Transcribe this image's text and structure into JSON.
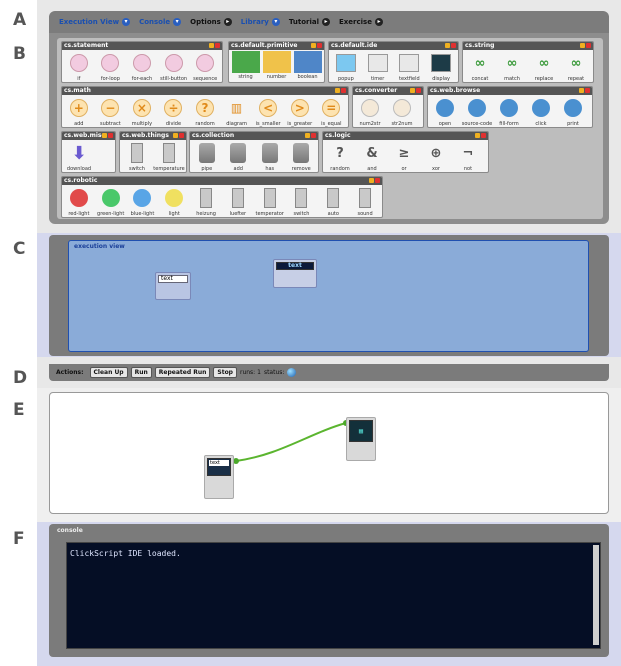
{
  "section_labels": [
    "A",
    "B",
    "C",
    "D",
    "E",
    "F"
  ],
  "menu": {
    "items": [
      {
        "label": "Execution View",
        "style": "blue"
      },
      {
        "label": "Console",
        "style": "blue"
      },
      {
        "label": "Options",
        "style": "dark"
      },
      {
        "label": "Library",
        "style": "blue"
      },
      {
        "label": "Tutorial",
        "style": "dark"
      },
      {
        "label": "Exercise",
        "style": "dark"
      }
    ]
  },
  "palettes": {
    "statement": {
      "title": "cs.statement",
      "items": [
        "if",
        "for-loop",
        "for-each",
        "still-button",
        "sequence"
      ]
    },
    "primitive": {
      "title": "cs.default.primitive",
      "items": [
        "string",
        "number",
        "boolean"
      ]
    },
    "ide": {
      "title": "cs.default.ide",
      "items": [
        "popup",
        "timer",
        "textfield",
        "display"
      ]
    },
    "string": {
      "title": "cs.string",
      "items": [
        "concat",
        "match",
        "replace",
        "repeat"
      ]
    },
    "math": {
      "title": "cs.math",
      "items": [
        "add",
        "subtract",
        "multiply",
        "divide",
        "random",
        "diagram",
        "is_smaller",
        "is_greater",
        "is_equal"
      ]
    },
    "converter": {
      "title": "cs.converter",
      "items": [
        "num2str",
        "str2num"
      ]
    },
    "browse": {
      "title": "cs.web.browse",
      "items": [
        "open",
        "source-code",
        "fill-form",
        "click",
        "print"
      ]
    },
    "misc": {
      "title": "cs.web.misc",
      "items": [
        "download"
      ]
    },
    "things": {
      "title": "cs.web.things",
      "items": [
        "switch",
        "temperature"
      ]
    },
    "collection": {
      "title": "cs.collection",
      "items": [
        "pipe",
        "add",
        "has",
        "remove"
      ]
    },
    "logic": {
      "title": "cs.logic",
      "items": [
        "random",
        "and",
        "or",
        "xor",
        "not"
      ]
    },
    "robotic": {
      "title": "cs.robotic",
      "items": [
        "red-light",
        "green-light",
        "blue-light",
        "light",
        "heizung",
        "luefter",
        "temperator",
        "switch",
        "auto",
        "sound"
      ]
    }
  },
  "icons": {
    "primitive": {
      "string": "#4aa84a",
      "number": "#f0c24a",
      "boolean": "#4f86c8"
    },
    "math": {
      "add": "+",
      "subtract": "−",
      "multiply": "×",
      "divide": "÷",
      "random": "?",
      "diagram": "▥",
      "is_smaller": "<",
      "is_greater": ">",
      "is_equal": "="
    },
    "logic": [
      "?",
      "&",
      "≥",
      "⊕",
      "¬"
    ],
    "lights": {
      "red-light": "#e14a4a",
      "green-light": "#4ac86a",
      "blue-light": "#59a5e6",
      "light": "#f0e060"
    }
  },
  "execution": {
    "title": "execution view",
    "widget1_text": "text",
    "widget2_text": "text"
  },
  "actions": {
    "label": "Actions:",
    "buttons": [
      "Clean Up",
      "Run",
      "Repeated Run",
      "Stop"
    ],
    "runs_label": "runs: 1",
    "status_label": "status:"
  },
  "canvas": {
    "node_text": "text"
  },
  "console": {
    "title": "console",
    "output": "ClickScript IDE loaded."
  }
}
